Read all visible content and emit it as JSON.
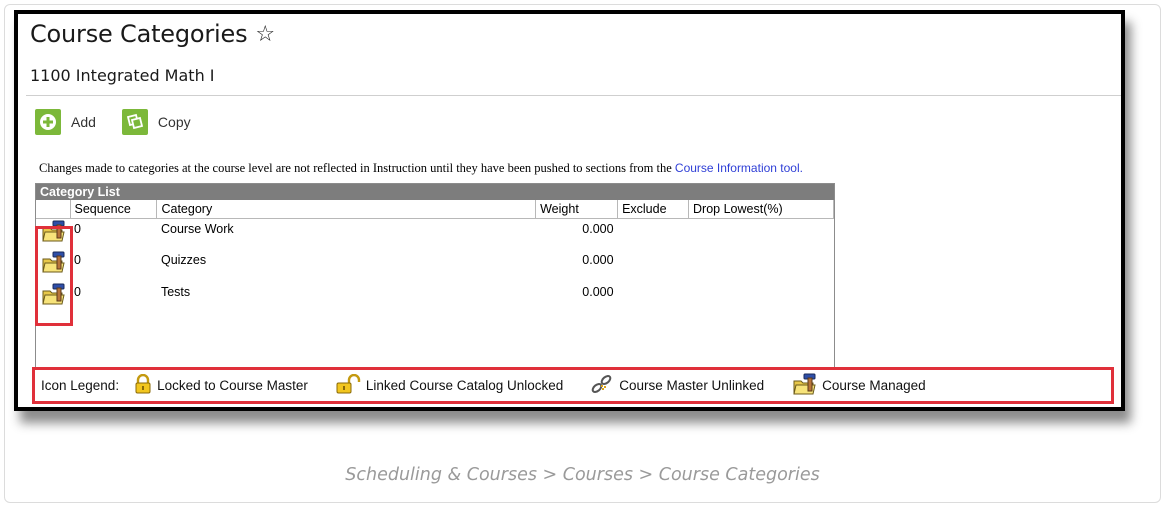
{
  "header": {
    "title": "Course Categories",
    "star_icon": "star-outline-icon",
    "subtitle": "1100 Integrated Math I"
  },
  "toolbar": {
    "add_label": "Add",
    "add_icon": "plus-circle-icon",
    "copy_label": "Copy",
    "copy_icon": "copy-icon",
    "accent_color": "#7cb83a"
  },
  "info": {
    "text": "Changes made to categories at the course level are not reflected in Instruction until they have been pushed to sections from the ",
    "link_text": "Course Information tool."
  },
  "category_list": {
    "title": "Category List",
    "columns": [
      "",
      "Sequence",
      "Category",
      "Weight",
      "Exclude",
      "Drop Lowest(%)"
    ],
    "rows": [
      {
        "icon": "course-managed-icon",
        "sequence": "0",
        "category": "Course Work",
        "weight": "0.000",
        "exclude": "",
        "drop_lowest": ""
      },
      {
        "icon": "course-managed-icon",
        "sequence": "0",
        "category": "Quizzes",
        "weight": "0.000",
        "exclude": "",
        "drop_lowest": ""
      },
      {
        "icon": "course-managed-icon",
        "sequence": "0",
        "category": "Tests",
        "weight": "0.000",
        "exclude": "",
        "drop_lowest": ""
      }
    ]
  },
  "legend": {
    "label": "Icon Legend:",
    "items": [
      {
        "icon": "padlock-locked-icon",
        "label": "Locked to Course Master"
      },
      {
        "icon": "padlock-unlocked-icon",
        "label": "Linked Course Catalog Unlocked"
      },
      {
        "icon": "broken-link-icon",
        "label": "Course Master Unlinked"
      },
      {
        "icon": "course-managed-icon",
        "label": "Course Managed"
      }
    ]
  },
  "highlight_color": "#e0303a",
  "caption": "Scheduling & Courses > Courses > Course Categories"
}
